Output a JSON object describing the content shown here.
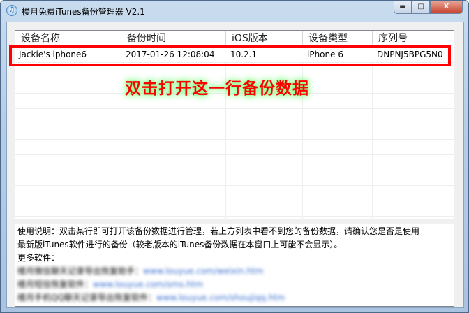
{
  "window": {
    "title": "楼月免费iTunes备份管理器 V2.1",
    "minimize": "▬",
    "maximize": "□",
    "close": "X"
  },
  "list": {
    "columns": [
      "设备名称",
      "备份时间",
      "iOS版本",
      "设备类型",
      "序列号"
    ],
    "rows": [
      [
        "Jackie's iphone6",
        "2017-01-26 12:08:04",
        "10.2.1",
        "iPhone 6",
        "DNPNJ5BPG5N0"
      ]
    ]
  },
  "annotation": "双击打开这一行备份数据",
  "info": {
    "line1": "使用说明：双击某行即可打开该备份数据进行管理，若上方列表中看不到您的备份数据，请确认您是否是使用",
    "line2": "最新版iTunes软件进行的备份（较老版本的iTunes备份数据在本窗口上可能不会显示）。",
    "more": "更多软件：",
    "links": [
      {
        "name": "楼月微信聊天记录导出恢复助手：",
        "url": "www.louyue.com/weixin.htm"
      },
      {
        "name": "楼月短信恢复软件：",
        "url": "www.louyue.com/sms.htm"
      },
      {
        "name": "楼月手机QQ聊天记录导出恢复软件：",
        "url": "www.louyue.com/shoujiqq.htm"
      }
    ]
  },
  "colors": {
    "highlight": "#ff0000",
    "glow": "#99ff99"
  }
}
